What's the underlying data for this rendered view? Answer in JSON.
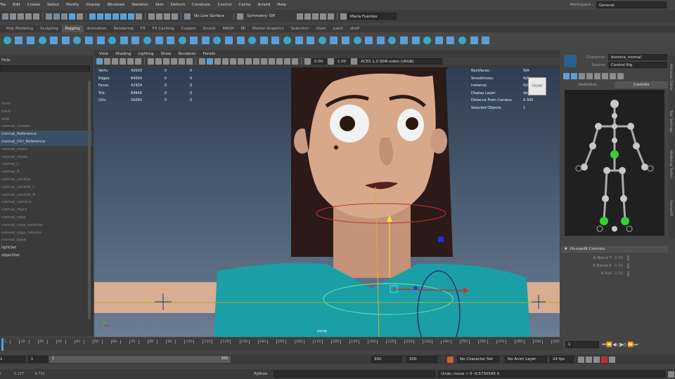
{
  "menu": {
    "items": [
      "File",
      "Edit",
      "Create",
      "Select",
      "Modify",
      "Display",
      "Windows",
      "Skeleton",
      "Skin",
      "Deform",
      "Constrain",
      "Control",
      "Cache",
      "Arnold",
      "Help"
    ],
    "workspace_label": "Workspace :",
    "workspace_value": "General"
  },
  "statusline": {
    "live_surface": "No Live Surface",
    "symmetry": "Symmetry: Off",
    "user": "Maria Fuentes"
  },
  "shelf": {
    "tabs": [
      "Poly Modeling",
      "Sculpting",
      "Rigging",
      "Animation",
      "Rendering",
      "FX",
      "FX Caching",
      "Custom",
      "Arnold",
      "MASH",
      "MI",
      "Motion Graphics",
      "Selection",
      "XGen",
      "paint",
      "shelf"
    ],
    "active_tab": "Rigging"
  },
  "outliner": {
    "header": "Help",
    "items": [
      {
        "label": "front",
        "state": "dim"
      },
      {
        "label": "back",
        "state": "dim"
      },
      {
        "label": "side",
        "state": "dim"
      },
      {
        "label": "normal_Guides",
        "state": "dim"
      },
      {
        "label": "normal_Reference",
        "state": "selected"
      },
      {
        "label": "normal_Ctrl_Reference",
        "state": "selected"
      },
      {
        "label": "normal_mesh",
        "state": "dim"
      },
      {
        "label": "normal_chest",
        "state": "dim"
      },
      {
        "label": "normal_L",
        "state": "dim"
      },
      {
        "label": "normal_R",
        "state": "dim"
      },
      {
        "label": "normal_necklid",
        "state": "dim"
      },
      {
        "label": "normal_necklid_L",
        "state": "dim"
      },
      {
        "label": "normal_necklid_R",
        "state": "dim"
      },
      {
        "label": "normal_camera",
        "state": "dim"
      },
      {
        "label": "normal_Hairs",
        "state": "dim"
      },
      {
        "label": "normal_ropa",
        "state": "dim"
      },
      {
        "label": "normal_ropa_exterior",
        "state": "dim"
      },
      {
        "label": "normal_ropa_interior",
        "state": "dim"
      },
      {
        "label": "normal_base",
        "state": "dim"
      },
      {
        "label": "lightSet",
        "state": "bright"
      },
      {
        "label": "objectSet",
        "state": "bright"
      }
    ]
  },
  "viewport": {
    "menu": [
      "View",
      "Shading",
      "Lighting",
      "Show",
      "Renderer",
      "Panels"
    ],
    "near": "0.00",
    "far": "1.00",
    "colorspace": "ACES 1.0 SDR-video (sRGB)",
    "hud_left": [
      {
        "k": "Verts:",
        "v": [
          "42000",
          "0",
          "0"
        ]
      },
      {
        "k": "Edges:",
        "v": [
          "84064",
          "0",
          "0"
        ]
      },
      {
        "k": "Faces:",
        "v": [
          "42424",
          "0",
          "0"
        ]
      },
      {
        "k": "Tris:",
        "v": [
          "84848",
          "0",
          "0"
        ]
      },
      {
        "k": "UVs:",
        "v": [
          "50060",
          "0",
          "0"
        ]
      }
    ],
    "hud_right": [
      {
        "k": "Backfaces:",
        "v": "N/A"
      },
      {
        "k": "Smoothness:",
        "v": "N/A"
      },
      {
        "k": "Instance:",
        "v": "N/A"
      },
      {
        "k": "Display Layer:",
        "v": "default"
      },
      {
        "k": "Distance From Camera:",
        "v": "0.300"
      },
      {
        "k": "Selected Objects:",
        "v": "1"
      }
    ],
    "cube_label": "FRONT",
    "camera_label": "persp"
  },
  "humanik": {
    "character_label": "Character:",
    "character_value": "doctora_normal",
    "source_label": "Source:",
    "source_value": "Control Rig",
    "tabs": [
      "Definition",
      "Controls"
    ],
    "active_tab": "Controls",
    "section_title": "HumanIK Controls",
    "controls": [
      {
        "label": "R Blend T",
        "value": "0.00"
      },
      {
        "label": "R Blend R",
        "value": "0.00"
      },
      {
        "label": "R Pull",
        "value": "0.00"
      }
    ],
    "side_tabs": [
      "Attribute Editor",
      "Tool Settings",
      "Modeling Toolkit",
      "HumanIK"
    ]
  },
  "timeline": {
    "ticks": [
      1,
      5,
      10,
      15,
      20,
      25,
      30,
      35,
      40,
      45,
      50,
      55,
      60,
      65,
      70,
      75,
      80,
      85,
      90,
      95,
      100,
      105,
      110,
      115,
      120,
      125,
      130,
      135,
      140,
      145,
      150,
      155,
      160,
      165,
      170,
      175,
      180,
      185,
      190,
      195,
      200,
      205,
      210,
      215,
      220,
      225,
      230,
      235,
      240,
      245,
      250,
      255,
      260,
      265,
      270,
      275,
      280,
      285,
      290,
      295,
      300
    ],
    "current_frame": "1",
    "range_start": "1",
    "range_start2": "1",
    "range_slider_start": "1",
    "range_slider_end": "300",
    "range_end": "300",
    "range_end2": "300",
    "character_set": "No Character Set",
    "anim_layer": "No Anim Layer",
    "fps": "24 fps"
  },
  "commandline": {
    "coords": [
      "0",
      "5.127",
      "9.791"
    ],
    "language": "Python",
    "result": "Undo: move -r 0 -0.5730545 0"
  },
  "colors": {
    "viewport_top": "#2f3d52",
    "viewport_bottom": "#6a7d93",
    "shirt": "#1a9fa6",
    "skin": "#d8a88a",
    "hair": "#2b1a17",
    "accent_blue": "#5aa0d8"
  }
}
